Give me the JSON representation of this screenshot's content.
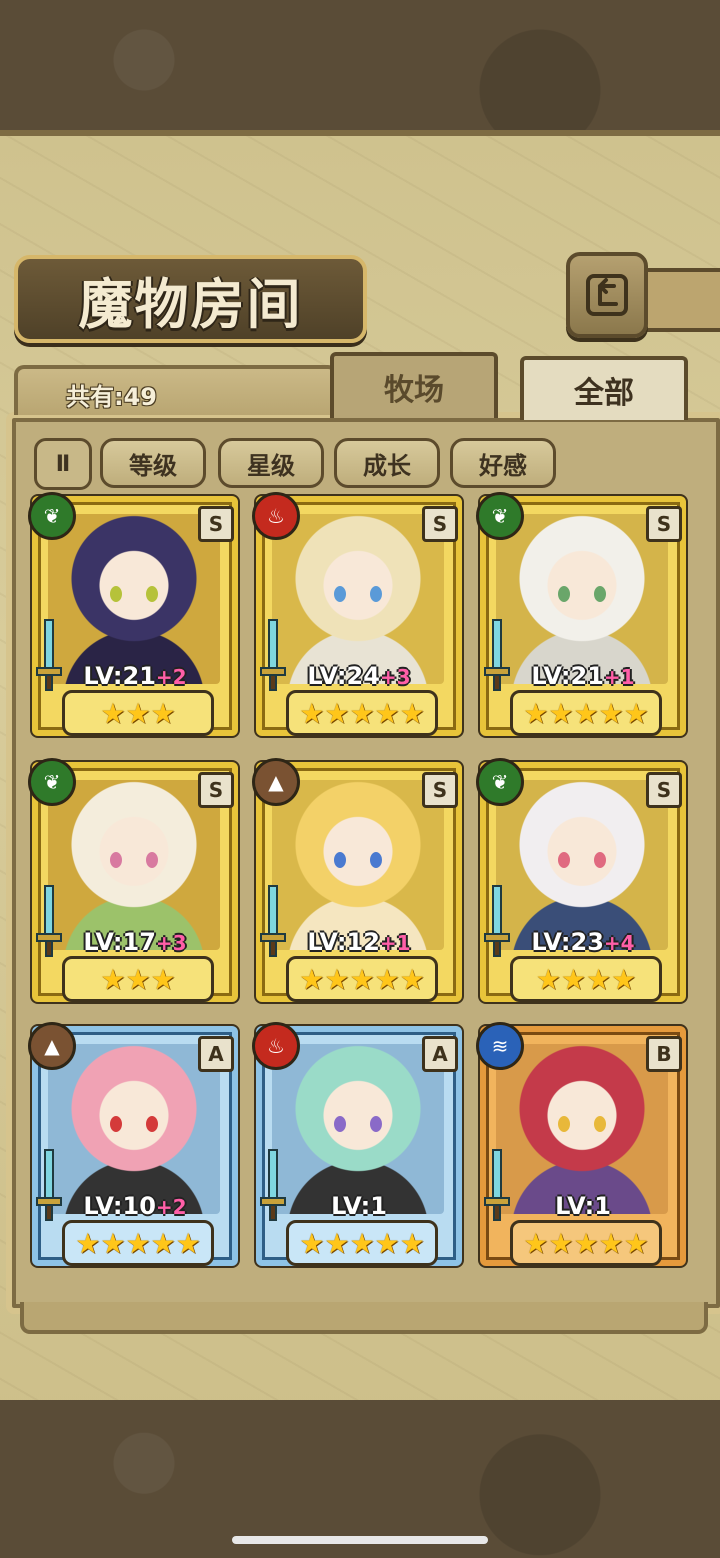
{
  "title": "魔物房间",
  "count_label": "共有:49",
  "tabs": {
    "ranch": "牧场",
    "all": "全部"
  },
  "filters": {
    "toggle": "Ⅱ",
    "level": "等级",
    "star": "星级",
    "growth": "成长",
    "affection": "好感"
  },
  "cards": [
    {
      "element": "leaf-icon",
      "rank": "S",
      "level": "LV:21",
      "plus": "+2",
      "stars": "★★★",
      "frame": "gold"
    },
    {
      "element": "fire-icon",
      "rank": "S",
      "level": "LV:24",
      "plus": "+3",
      "stars": "★★★★★",
      "frame": "gold"
    },
    {
      "element": "leaf-icon",
      "rank": "S",
      "level": "LV:21",
      "plus": "+1",
      "stars": "★★★★★",
      "frame": "gold"
    },
    {
      "element": "leaf-icon",
      "rank": "S",
      "level": "LV:17",
      "plus": "+3",
      "stars": "★★★",
      "frame": "gold"
    },
    {
      "element": "mountain-icon",
      "rank": "S",
      "level": "LV:12",
      "plus": "+1",
      "stars": "★★★★★",
      "frame": "gold"
    },
    {
      "element": "leaf-icon",
      "rank": "S",
      "level": "LV:23",
      "plus": "+4",
      "stars": "★★★★",
      "frame": "gold"
    },
    {
      "element": "mountain-icon",
      "rank": "A",
      "level": "LV:10",
      "plus": "+2",
      "stars": "★★★★★",
      "frame": "blue"
    },
    {
      "element": "fire-icon",
      "rank": "A",
      "level": "LV:1",
      "plus": "",
      "stars": "★★★★★",
      "frame": "blue"
    },
    {
      "element": "water-icon",
      "rank": "B",
      "level": "LV:1",
      "plus": "",
      "stars": "★★★★★",
      "frame": "orange"
    }
  ],
  "colors": {
    "gold": "#e8c43a",
    "blue": "#6aa7d6",
    "orange": "#d98a2a",
    "leaf": "#2f7a2a",
    "fire": "#c42a1e",
    "mountain": "#7a5232",
    "water": "#2a62b8"
  }
}
